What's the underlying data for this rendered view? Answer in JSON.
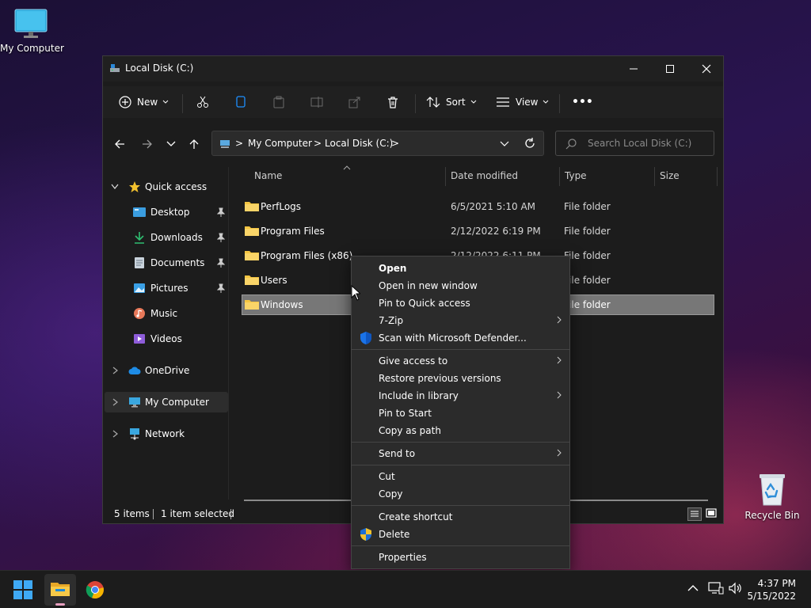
{
  "desktop": {
    "icons": [
      {
        "label": "My Computer"
      },
      {
        "label": "Recycle Bin"
      }
    ]
  },
  "window": {
    "title": "Local Disk (C:)",
    "toolbar": {
      "new_label": "New",
      "sort_label": "Sort",
      "view_label": "View",
      "more_label": "•••"
    },
    "address": {
      "crumbs": [
        "My Computer",
        "Local Disk (C:)"
      ],
      "separator": ">"
    },
    "search": {
      "placeholder": "Search Local Disk (C:)"
    },
    "sidebar": {
      "quick_access": "Quick access",
      "items": [
        {
          "label": "Desktop",
          "icon": "desktop-folder-icon",
          "pinned": true
        },
        {
          "label": "Downloads",
          "icon": "download-arrow-icon",
          "pinned": true
        },
        {
          "label": "Documents",
          "icon": "documents-icon",
          "pinned": true
        },
        {
          "label": "Pictures",
          "icon": "pictures-icon",
          "pinned": true
        },
        {
          "label": "Music",
          "icon": "music-icon",
          "pinned": false
        },
        {
          "label": "Videos",
          "icon": "videos-icon",
          "pinned": false
        }
      ],
      "onedrive": "OneDrive",
      "my_computer": "My Computer",
      "network": "Network"
    },
    "columns": {
      "name": "Name",
      "date": "Date modified",
      "type": "Type",
      "size": "Size"
    },
    "files": [
      {
        "name": "PerfLogs",
        "date": "6/5/2021 5:10 AM",
        "type": "File folder"
      },
      {
        "name": "Program Files",
        "date": "2/12/2022 6:19 PM",
        "type": "File folder"
      },
      {
        "name": "Program Files (x86)",
        "date": "2/12/2022 6:11 PM",
        "type": "File folder"
      },
      {
        "name": "Users",
        "date": "",
        "type": "File folder"
      },
      {
        "name": "Windows",
        "date": "",
        "type": "File folder"
      }
    ],
    "status": {
      "items": "5 items",
      "selected": "1 item selected"
    }
  },
  "context_menu": {
    "items": [
      {
        "label": "Open",
        "bold": true
      },
      {
        "label": "Open in new window"
      },
      {
        "label": "Pin to Quick access"
      },
      {
        "label": "7-Zip",
        "submenu": true
      },
      {
        "label": "Scan with Microsoft Defender...",
        "icon": "defender-shield-icon"
      },
      {
        "label": "Give access to",
        "submenu": true
      },
      {
        "label": "Restore previous versions"
      },
      {
        "label": "Include in library",
        "submenu": true
      },
      {
        "label": "Pin to Start"
      },
      {
        "label": "Copy as path"
      },
      {
        "label": "Send to",
        "submenu": true
      },
      {
        "label": "Cut"
      },
      {
        "label": "Copy"
      },
      {
        "label": "Create shortcut"
      },
      {
        "label": "Delete",
        "icon": "uac-shield-icon"
      },
      {
        "label": "Properties"
      }
    ]
  },
  "taskbar": {
    "time": "4:37 PM",
    "date": "5/15/2022",
    "apps": [
      "start-icon",
      "file-explorer-icon",
      "chrome-icon"
    ]
  },
  "colors": {
    "accent": "#0078d4",
    "folder": "#f4c542",
    "selected_row": "#777777",
    "menu_bg": "#2b2b2b"
  }
}
